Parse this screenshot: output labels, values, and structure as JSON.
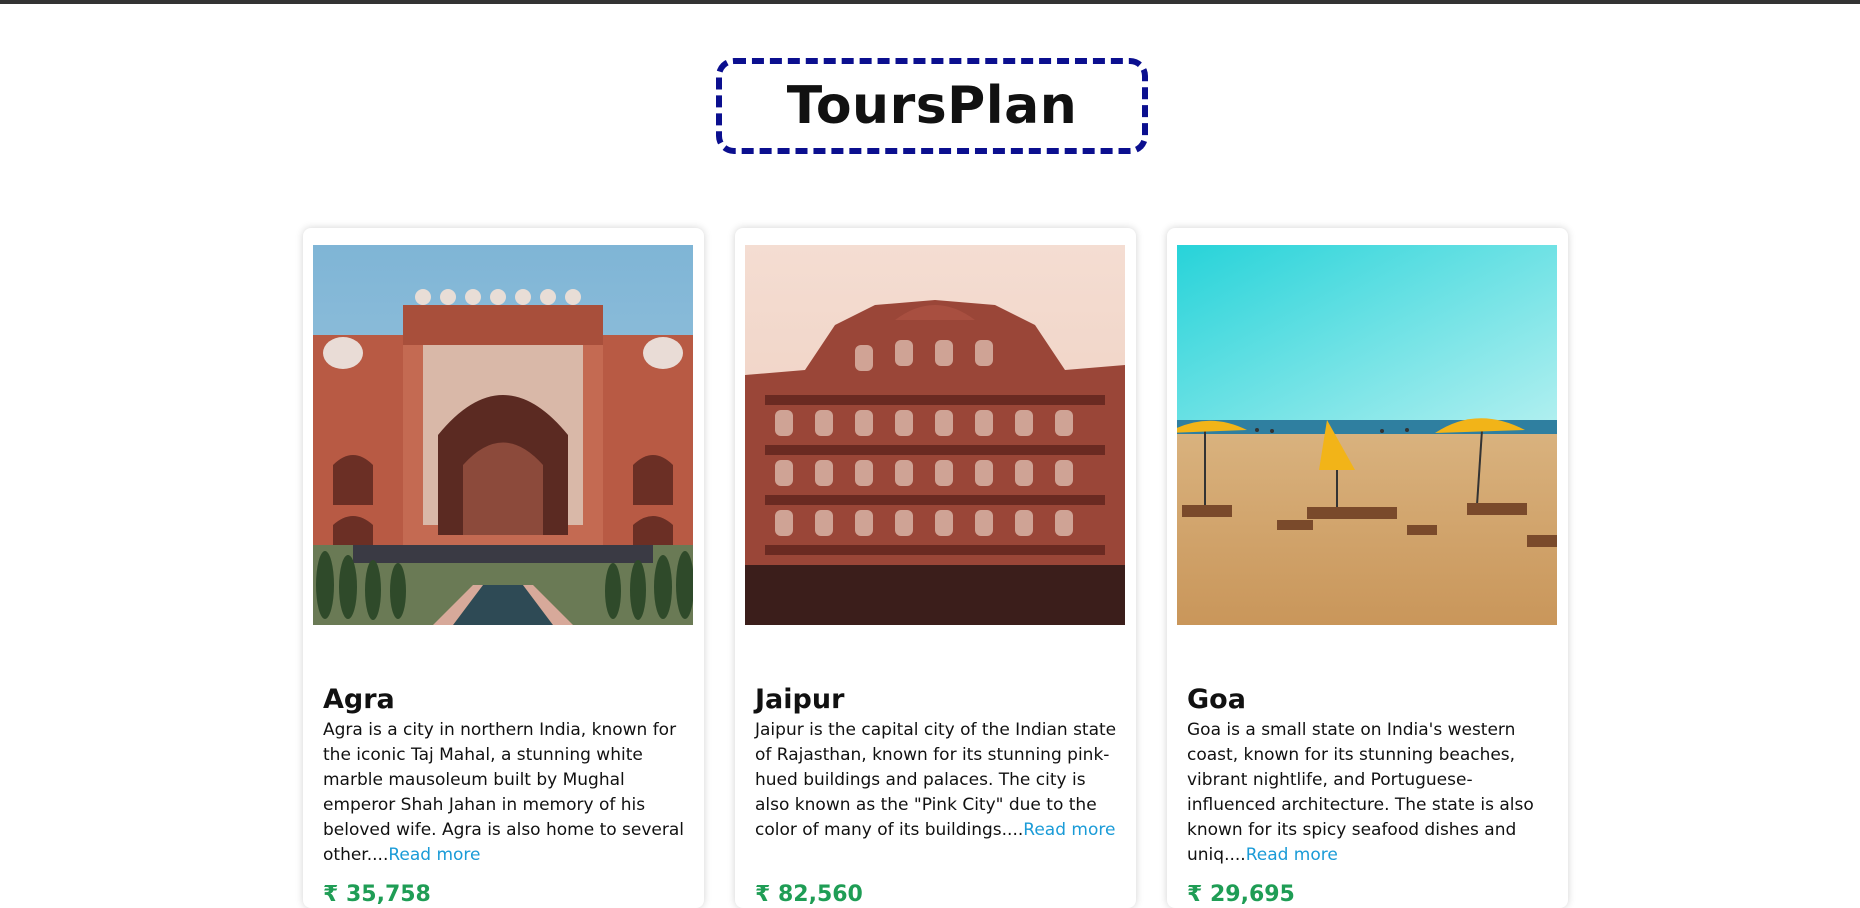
{
  "header": {
    "title": "ToursPlan"
  },
  "cards": [
    {
      "price": "₹ 35,758",
      "city": "Agra",
      "description": "Agra is a city in northern India, known for the iconic Taj Mahal, a stunning white marble mausoleum built by Mughal emperor Shah Jahan in memory of his beloved wife. Agra is also home to several other....",
      "read_more": "Read more"
    },
    {
      "price": "₹ 82,560",
      "city": "Jaipur",
      "description": "Jaipur is the capital city of the Indian state of Rajasthan, known for its stunning pink-hued buildings and palaces. The city is also known as the \"Pink City\" due to the color of many of its buildings....",
      "read_more": "Read more"
    },
    {
      "price": "₹ 29,695",
      "city": "Goa",
      "description": "Goa is a small state on India's western coast, known for its stunning beaches, vibrant nightlife, and Portuguese-influenced architecture. The state is also known for its spicy seafood dishes and uniq....",
      "read_more": "Read more"
    }
  ],
  "colors": {
    "title_border": "#0b0f8f",
    "price": "#1f9d55",
    "link": "#1a9bd7"
  }
}
